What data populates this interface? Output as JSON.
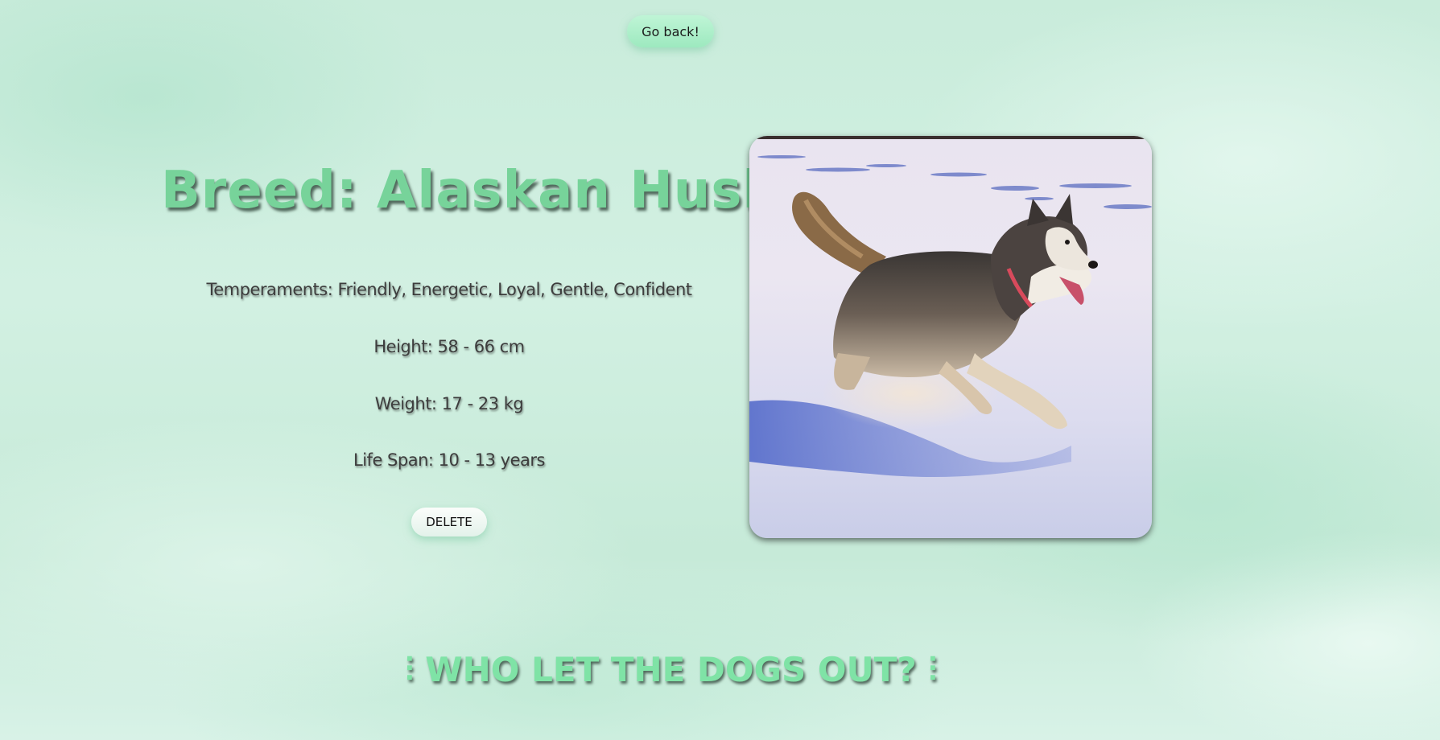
{
  "nav": {
    "go_back_label": "Go back!"
  },
  "breed": {
    "title": "Breed: Alaskan Husky",
    "temperaments": "Temperaments: Friendly, Energetic, Loyal, Gentle, Confident",
    "height": "Height: 58 - 66 cm",
    "weight": "Weight: 17 - 23 kg",
    "life_span": "Life Span: 10 - 13 years",
    "delete_label": "DELETE",
    "image_alt": "Alaskan Husky running in snow"
  },
  "footer": {
    "title": "⫶ WHO LET THE DOGS OUT? ⫶"
  },
  "colors": {
    "accent_green": "#77d39a",
    "button_green": "#9de9bf",
    "background": "#c9ecdb"
  }
}
